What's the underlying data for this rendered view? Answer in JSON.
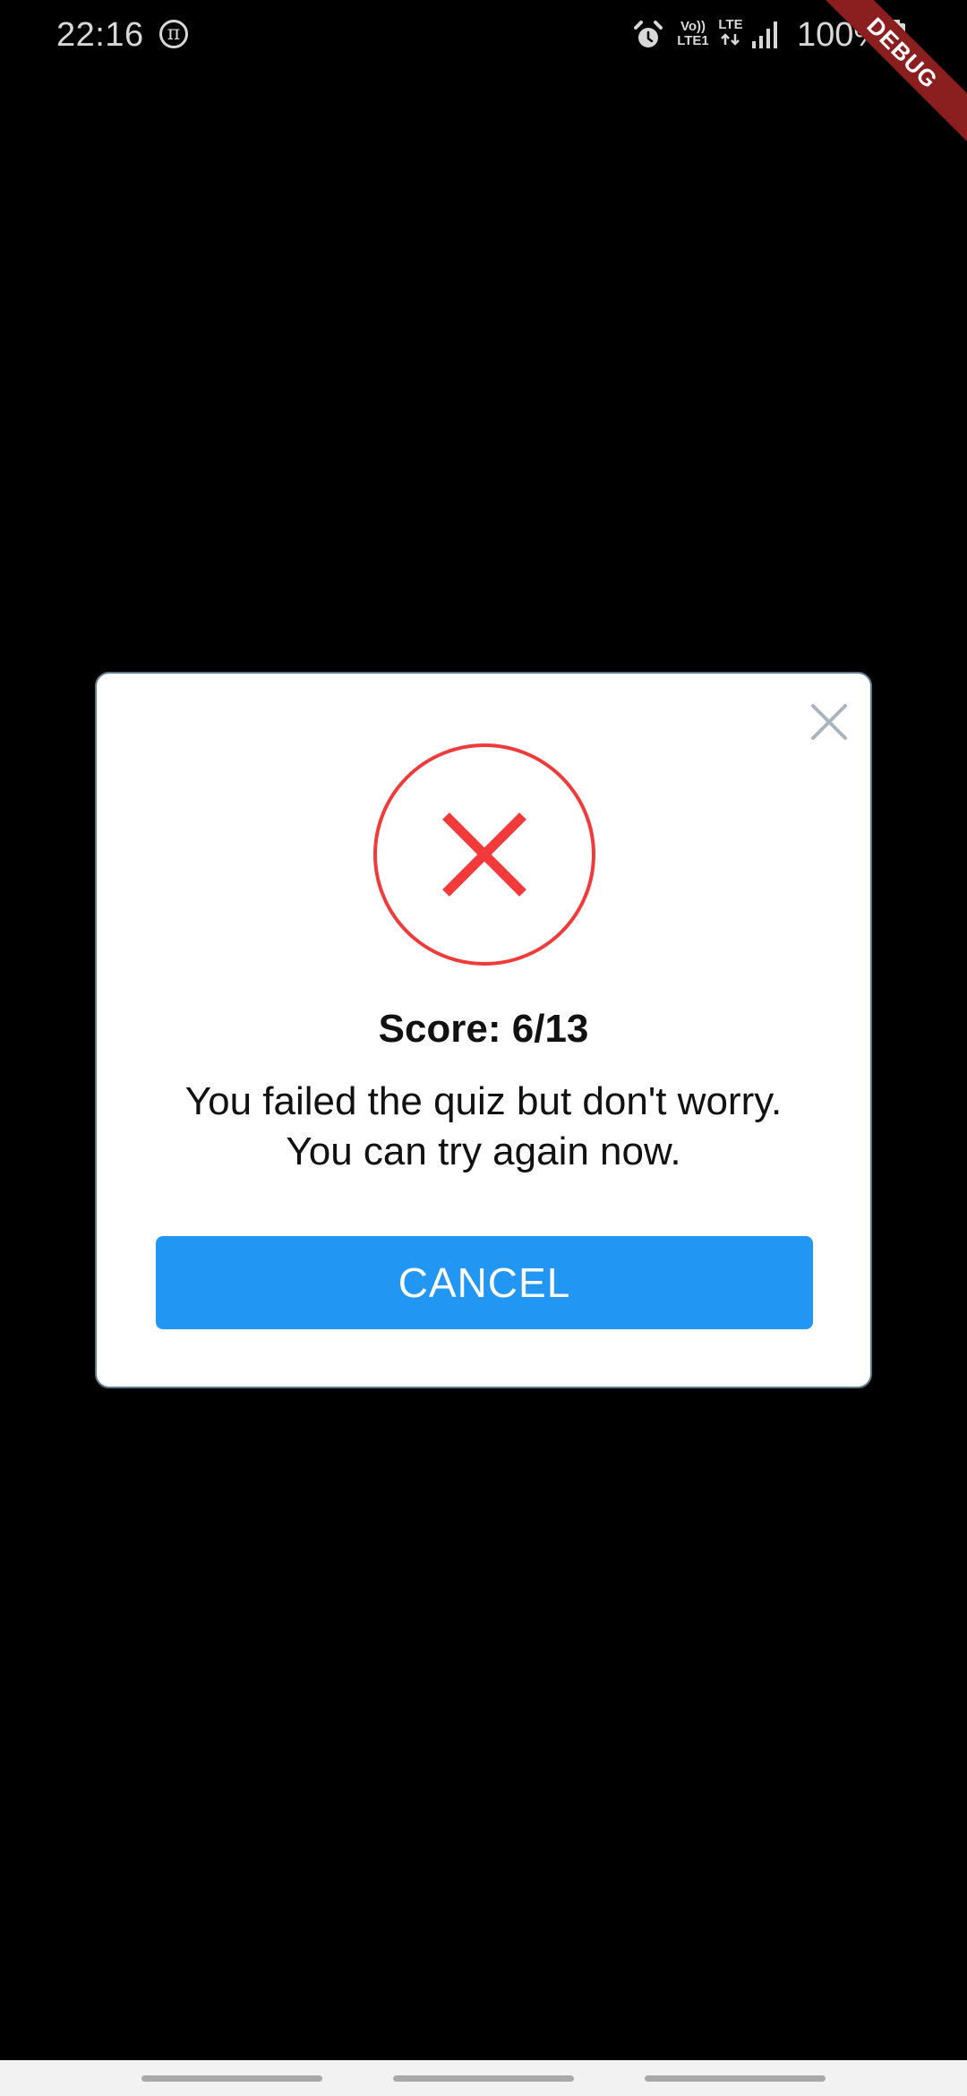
{
  "status_bar": {
    "time": "22:16",
    "app_icon": "pi-icon",
    "volte_line1": "Vo))",
    "volte_line2": "LTE1",
    "lte_label": "LTE",
    "battery_percent": "100%",
    "icons": [
      "alarm-icon",
      "volte-icon",
      "lte-icon",
      "signal-icon",
      "battery-icon"
    ]
  },
  "debug_banner": {
    "label": "DEBUG",
    "color": "#8b1e1e"
  },
  "dialog": {
    "close_icon": "close-icon",
    "status_icon": "fail-x-icon",
    "status_color": "#f23a3a",
    "score_text": "Score: 6/13",
    "message_line1": "You failed the quiz but don't worry.",
    "message_line2": "You can try again now.",
    "cancel_label": "CANCEL",
    "button_color": "#2196f3",
    "border_color": "#5e7a8a"
  },
  "nav_bar": {
    "pills": [
      "recents-bar",
      "home-bar",
      "back-bar"
    ]
  }
}
